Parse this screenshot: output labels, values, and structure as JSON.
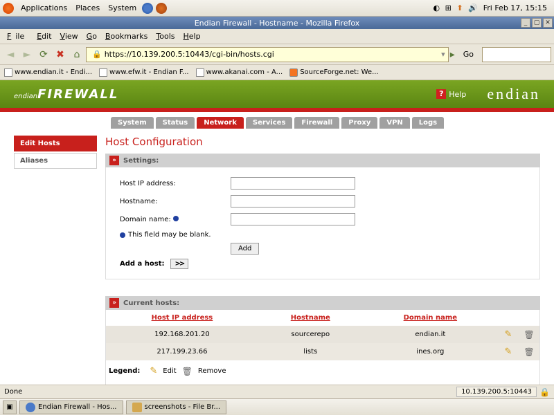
{
  "gnome": {
    "menus": [
      "Applications",
      "Places",
      "System"
    ],
    "clock": "Fri Feb 17, 15:15"
  },
  "firefox": {
    "title": "Endian Firewall - Hostname - Mozilla Firefox",
    "menu": {
      "file": "File",
      "edit": "Edit",
      "view": "View",
      "go": "Go",
      "bookmarks": "Bookmarks",
      "tools": "Tools",
      "help": "Help"
    },
    "url": "https://10.139.200.5:10443/cgi-bin/hosts.cgi",
    "go_label": "Go",
    "bookmarks": [
      "www.endian.it - Endi...",
      "www.efw.it - Endian F...",
      "www.akanai.com - A...",
      "SourceForge.net: We..."
    ],
    "status_left": "Done",
    "status_right": "10.139.200.5:10443"
  },
  "endian": {
    "logo_small": "endian",
    "logo_big": "FIREWALL",
    "help": "Help",
    "brand": "endian",
    "tabs": [
      "System",
      "Status",
      "Network",
      "Services",
      "Firewall",
      "Proxy",
      "VPN",
      "Logs"
    ],
    "active_tab": 2,
    "sidebar": [
      {
        "label": "Edit Hosts",
        "active": true
      },
      {
        "label": "Aliases",
        "active": false
      }
    ],
    "page_title": "Host Configuration",
    "settings": {
      "header": "Settings:",
      "host_ip_label": "Host IP address:",
      "hostname_label": "Hostname:",
      "domain_label": "Domain name:",
      "blank_note": "This field may be blank.",
      "add_btn": "Add",
      "add_host": "Add a host:"
    },
    "current": {
      "header": "Current hosts:",
      "cols": {
        "ip": "Host IP address",
        "host": "Hostname",
        "domain": "Domain name"
      },
      "rows": [
        {
          "ip": "192.168.201.20",
          "host": "sourcerepo",
          "domain": "endian.it"
        },
        {
          "ip": "217.199.23.66",
          "host": "lists",
          "domain": "ines.org"
        }
      ],
      "legend": "Legend:",
      "edit": "Edit",
      "remove": "Remove"
    }
  },
  "taskbar": {
    "tasks": [
      "Endian Firewall - Hos...",
      "screenshots - File Br..."
    ]
  }
}
